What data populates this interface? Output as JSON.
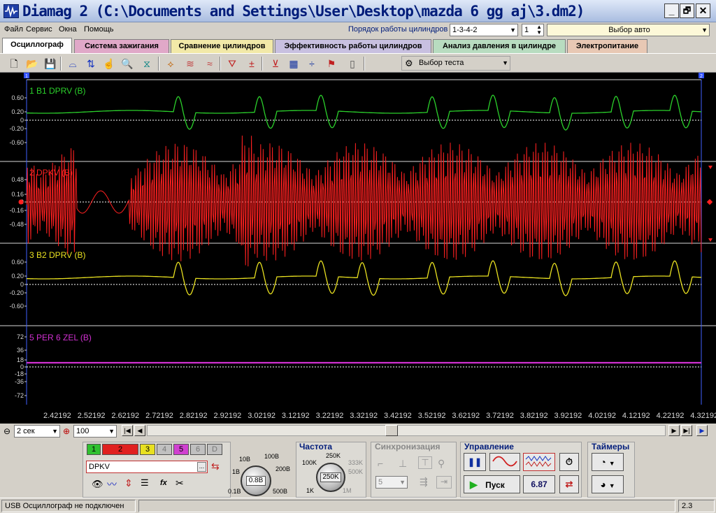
{
  "window": {
    "title": "Diamag 2 (C:\\Documents and Settings\\User\\Desktop\\mazda 6 gg aj\\3.dm2)",
    "min": "_",
    "max": "🗗",
    "close": "✕"
  },
  "menu": {
    "items": [
      "Файл",
      "Сервис",
      "Окна",
      "Помощь"
    ],
    "cyl_order_label": "Порядок работы цилиндров",
    "cyl_order_value": "1-3-4-2",
    "cyl_num_value": "1",
    "car_select": "Выбор авто"
  },
  "tabs": [
    {
      "label": "Осциллограф",
      "bg": "#ffffff"
    },
    {
      "label": "Система зажигания",
      "bg": "#e0a8c8"
    },
    {
      "label": "Сравнение цилиндров",
      "bg": "#f2e9a8"
    },
    {
      "label": "Эффективность работы цилиндров",
      "bg": "#c8c0e0"
    },
    {
      "label": "Анализ давления в цилиндре",
      "bg": "#b8dcc0"
    },
    {
      "label": "Электропитание",
      "bg": "#e8c8b4"
    }
  ],
  "toolbar": {
    "icons": [
      "new-file-icon",
      "open-file-icon",
      "save-icon",
      "cursor-a-icon",
      "cursor-b-icon",
      "hand-icon",
      "zoom-icon",
      "filter-icon",
      "sync-icon",
      "smooth-icon",
      "wave-icon",
      "auto-scale-icon",
      "zero-icon",
      "test-filter-icon",
      "grid-icon",
      "divider-icon",
      "flag-icon",
      "page-icon"
    ],
    "test_select": "Выбор теста"
  },
  "scope": {
    "colors": {
      "ch1": "#2bd02b",
      "ch2": "#ff2020",
      "ch3": "#e8e020",
      "ch4": "#d030d0",
      "grid": "#ffffff",
      "cursor": "#4060ff"
    },
    "channels": [
      {
        "label": "1 B1 DPRV (B)",
        "ticks": [
          "0.60",
          "0.20",
          "0",
          "-0.20",
          "-0.60"
        ]
      },
      {
        "label": "2 DPKV (B)",
        "ticks": [
          "0.48",
          "0.16",
          "0",
          "-0.16",
          "-0.48"
        ]
      },
      {
        "label": "3 B2 DPRV  (B)",
        "ticks": [
          "0.60",
          "0.20",
          "0",
          "-0.20",
          "-0.60"
        ]
      },
      {
        "label": "5 PER 6 ZEL  (B)",
        "ticks": [
          "72",
          "36",
          "18",
          "0",
          "-18",
          "-36",
          "-72"
        ]
      }
    ],
    "x_labels": [
      "2.42192",
      "2.52192",
      "2.62192",
      "2.72192",
      "2.82192",
      "2.92192",
      "3.02192",
      "3.12192",
      "3.22192",
      "3.32192",
      "3.42192",
      "3.52192",
      "3.62192",
      "3.72192",
      "3.82192",
      "3.92192",
      "4.02192",
      "4.12192",
      "4.22192",
      "4.32192"
    ],
    "cursor_a": "1",
    "cursor_b": "2"
  },
  "nav": {
    "time_select": "2 сек",
    "zoom_select": "100",
    "first_btn": "|◀",
    "prev_btn": "◀",
    "next_btn": "▶",
    "last_btn": "▶|",
    "play_btn": "▶"
  },
  "controls": {
    "channel_buttons": [
      {
        "label": "1",
        "bg": "#30c030"
      },
      {
        "label": "2",
        "bg": "#e02020"
      },
      {
        "label": "3",
        "bg": "#e8e020"
      },
      {
        "label": "4",
        "bg": "#c0c0c0"
      },
      {
        "label": "5",
        "bg": "#d040d0"
      },
      {
        "label": "6",
        "bg": "#c0c0c0"
      },
      {
        "label": "D",
        "bg": "#c0c0c0"
      }
    ],
    "channel_name": "DPKV",
    "browse": "...",
    "voltage": {
      "value": "0.8B",
      "marks": [
        "10B",
        "100B",
        "1B",
        "200B",
        "0.1B",
        "500B"
      ]
    },
    "frequency": {
      "title": "Частота",
      "value": "250K",
      "marks": [
        "250K",
        "100K",
        "333K",
        "500K",
        "1K",
        "1M"
      ]
    },
    "sync": {
      "title": "Синхронизация",
      "value": "5"
    },
    "control": {
      "title": "Управление",
      "start": "Пуск",
      "value": "6.87"
    },
    "timers": {
      "title": "Таймеры"
    }
  },
  "status": {
    "left": "USB Осциллограф не подключен",
    "right": "2.3"
  }
}
